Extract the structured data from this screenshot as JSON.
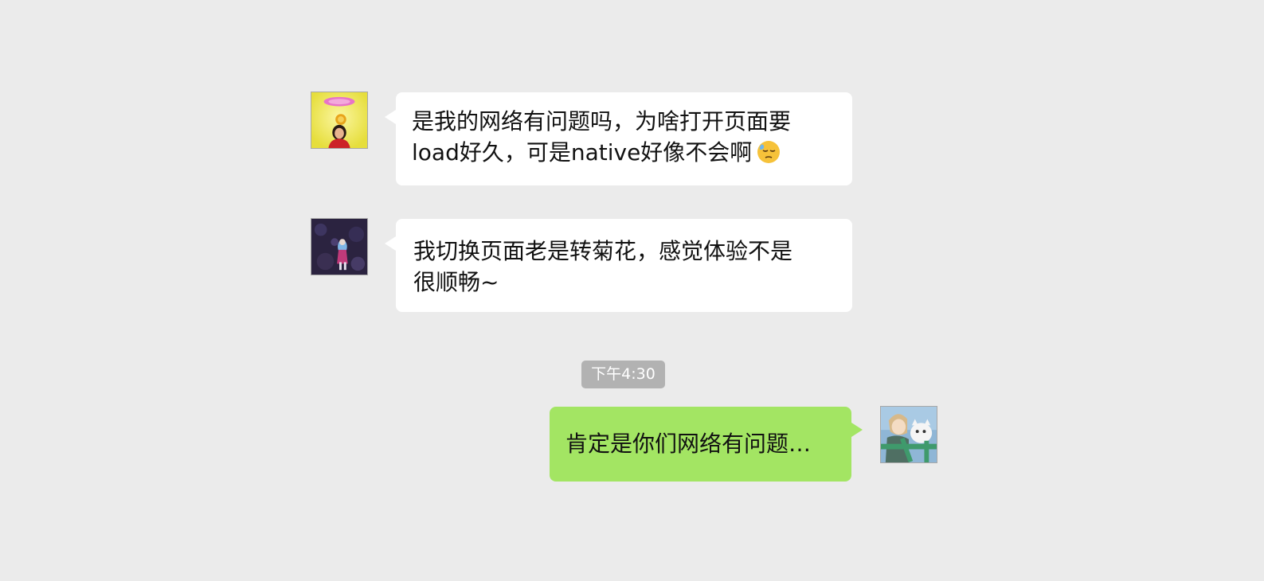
{
  "messages": [
    {
      "direction": "incoming",
      "line1": "是我的网络有问题吗，为啥打开页面要",
      "line2": "load好久，可是native好像不会啊",
      "emoji": "downcast-sweat-face-emoji",
      "avatar": "avatar-girl-halo"
    },
    {
      "direction": "incoming",
      "line1": "我切换页面老是转菊花，感觉体验不是",
      "line2": "很顺畅~",
      "avatar": "avatar-dark-figure"
    },
    {
      "direction": "outgoing",
      "line1": "肯定是你们网络有问题…",
      "avatar": "avatar-anime-boy-cat"
    }
  ],
  "timestamp": "下午4:30",
  "colors": {
    "background": "#ebebeb",
    "incoming_bubble": "#ffffff",
    "outgoing_bubble": "#a3e563",
    "time_badge": "#b2b2b2"
  }
}
